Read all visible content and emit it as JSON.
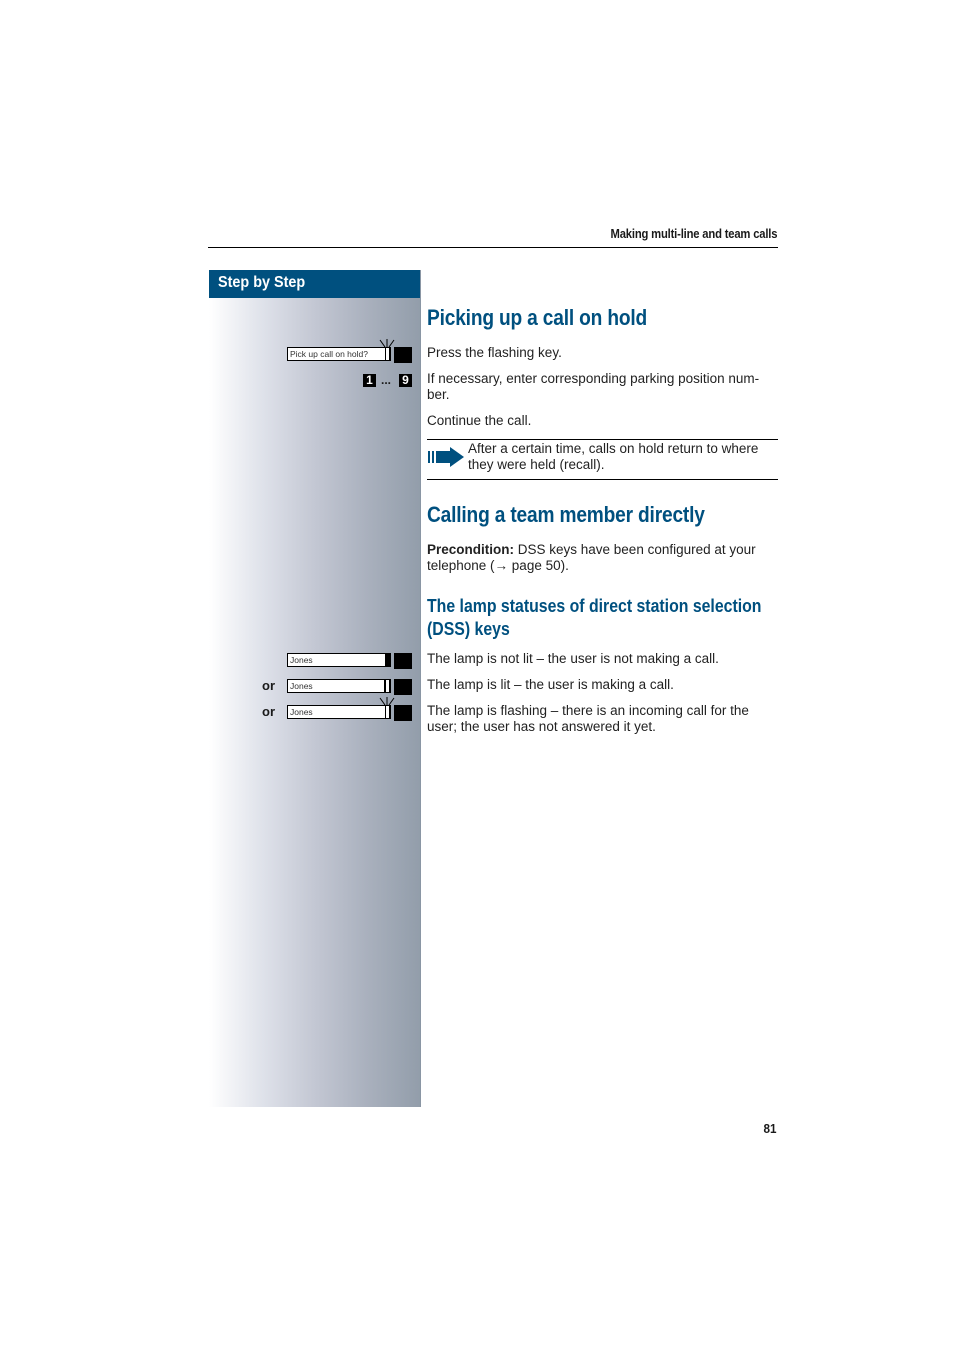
{
  "header": {
    "section_title": "Making multi-line and team calls"
  },
  "sidebar": {
    "title": "Step by Step",
    "displays": {
      "pickup": "Pick up call on hold?",
      "dss_1": "Jones",
      "dss_2": "Jones",
      "dss_3": "Jones"
    },
    "or_label_1": "or",
    "or_label_2": "or",
    "digit_first": "1",
    "digit_ellipsis": "...",
    "digit_last": "9"
  },
  "section1": {
    "heading": "Picking up a call on hold",
    "step1": "Press the flashing key.",
    "step2": "If necessary, enter corresponding parking position num-ber.",
    "step3": "Continue the call.",
    "note": "After a certain time, calls on hold return to where they were held (recall)."
  },
  "section2": {
    "heading": "Calling a team member directly",
    "precondition_label": "Precondition:",
    "precondition_text": " DSS keys have been configured at your telephone (→ page 50).",
    "subheading": "The lamp statuses of direct station selection (DSS) keys",
    "lamp_off": "The lamp is not lit – the user is not making a call.",
    "lamp_on": "The lamp is lit – the user is making a call.",
    "lamp_flash": "The lamp is flashing – there is an incoming call for the user; the user has not answered it yet."
  },
  "footer": {
    "page_number": "81"
  }
}
